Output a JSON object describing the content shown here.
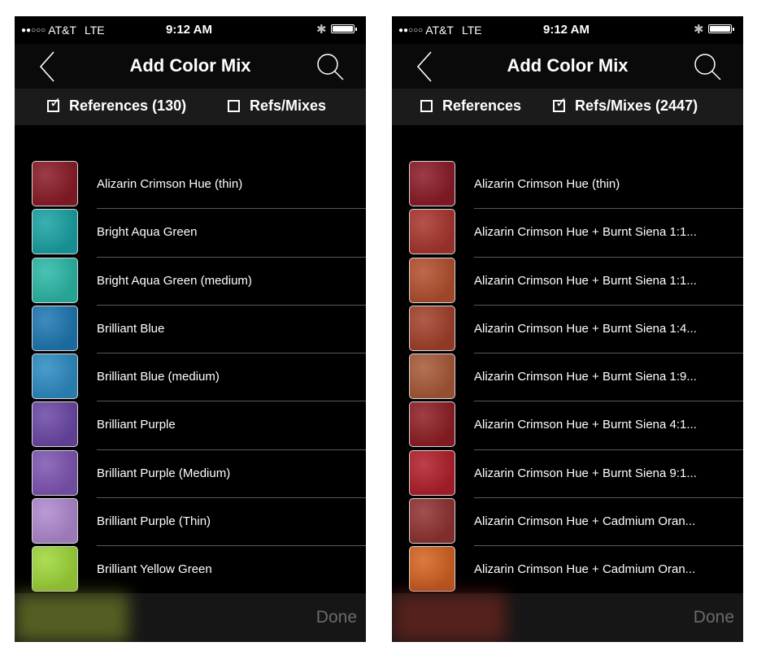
{
  "screens": [
    {
      "status_bar": {
        "dots": "●●○○○",
        "carrier": "AT&T",
        "network": "LTE",
        "time": "9:12 AM",
        "icons": [
          "bluetooth-icon",
          "battery-icon"
        ]
      },
      "nav": {
        "back_icon": "chevron-left-icon",
        "title": "Add Color Mix",
        "search_icon": "search-icon"
      },
      "filters": [
        {
          "label": "References (130)",
          "checked": true
        },
        {
          "label": "Refs/Mixes",
          "checked": false
        }
      ],
      "rows": [
        {
          "label": "Alizarin Crimson Hue (thin)",
          "color": "#8b1c28"
        },
        {
          "label": "Bright Aqua Green",
          "color": "#1aa3a4"
        },
        {
          "label": "Bright Aqua Green (medium)",
          "color": "#2cb9a8"
        },
        {
          "label": "Brilliant Blue",
          "color": "#1f79b3"
        },
        {
          "label": "Brilliant Blue (medium)",
          "color": "#2d8cc3"
        },
        {
          "label": "Brilliant Purple",
          "color": "#6c48a6"
        },
        {
          "label": "Brilliant Purple (Medium)",
          "color": "#8056b4"
        },
        {
          "label": "Brilliant Purple (Thin)",
          "color": "#b08ad0"
        },
        {
          "label": "Brilliant Yellow Green",
          "color": "#9fd83a"
        }
      ],
      "bottom": {
        "done_label": "Done",
        "blob_color": "#8a9a2c"
      }
    },
    {
      "status_bar": {
        "dots": "●●○○○",
        "carrier": "AT&T",
        "network": "LTE",
        "time": "9:12 AM",
        "icons": [
          "bluetooth-icon",
          "battery-icon"
        ]
      },
      "nav": {
        "back_icon": "chevron-left-icon",
        "title": "Add Color Mix",
        "search_icon": "search-icon"
      },
      "filters": [
        {
          "label": "References",
          "checked": false
        },
        {
          "label": "Refs/Mixes (2447)",
          "checked": true
        }
      ],
      "rows": [
        {
          "label": "Alizarin Crimson Hue (thin)",
          "color": "#8b1c28"
        },
        {
          "label": "Alizarin Crimson Hue + Burnt Siena 1:1...",
          "color": "#a9362f"
        },
        {
          "label": "Alizarin Crimson Hue + Burnt Siena 1:1...",
          "color": "#b4502e"
        },
        {
          "label": "Alizarin Crimson Hue + Burnt Siena 1:4...",
          "color": "#a4412c"
        },
        {
          "label": "Alizarin Crimson Hue + Burnt Siena 1:9...",
          "color": "#a95a38"
        },
        {
          "label": "Alizarin Crimson Hue + Burnt Siena 4:1...",
          "color": "#8f1f26"
        },
        {
          "label": "Alizarin Crimson Hue + Burnt Siena 9:1...",
          "color": "#b3202c"
        },
        {
          "label": "Alizarin Crimson Hue + Cadmium Oran...",
          "color": "#913332"
        },
        {
          "label": "Alizarin Crimson Hue + Cadmium Oran...",
          "color": "#d46322"
        }
      ],
      "bottom": {
        "done_label": "Done",
        "blob_color": "#8a2a22"
      }
    }
  ]
}
